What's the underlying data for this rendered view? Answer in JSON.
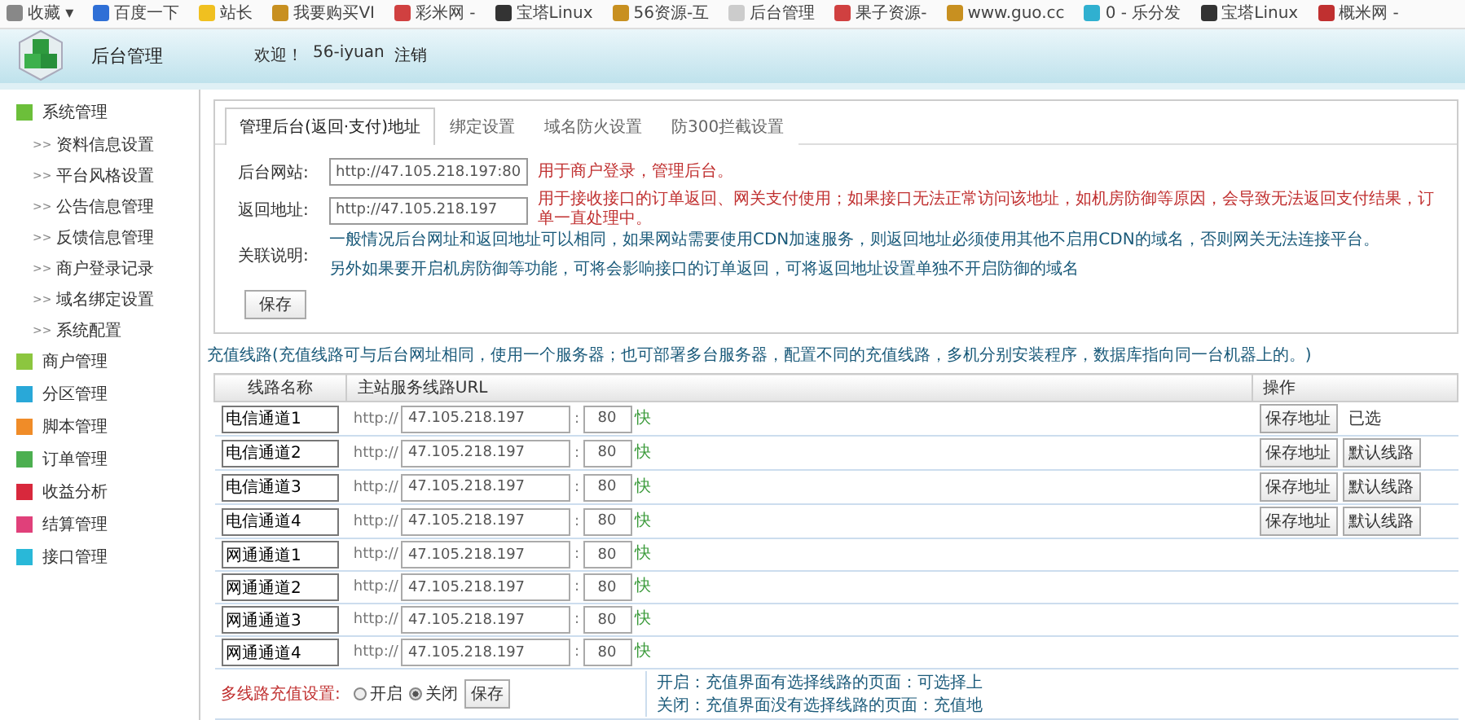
{
  "bookmarks": [
    {
      "label": "收藏 ▾",
      "color": "#888888"
    },
    {
      "label": "百度一下",
      "color": "#2f6fd6"
    },
    {
      "label": "站长",
      "color": "#f0c020"
    },
    {
      "label": "我要购买VI",
      "color": "#c89020"
    },
    {
      "label": "彩米网 -",
      "color": "#d04040"
    },
    {
      "label": "宝塔Linux",
      "color": "#333333"
    },
    {
      "label": "56资源-互",
      "color": "#c89020"
    },
    {
      "label": "后台管理",
      "color": "#cccccc"
    },
    {
      "label": "果子资源-",
      "color": "#d04040"
    },
    {
      "label": "www.guo.cc",
      "color": "#c89020"
    },
    {
      "label": "0 - 乐分发",
      "color": "#30b0d0"
    },
    {
      "label": "宝塔Linux",
      "color": "#333333"
    },
    {
      "label": "概米网 -",
      "color": "#c03030"
    }
  ],
  "header": {
    "title": "后台管理",
    "welcome": "欢迎！",
    "user": "56-iyuan",
    "logout": "注销"
  },
  "sidebar": [
    {
      "label": "系统管理",
      "color": "#6cbf3a",
      "children": [
        {
          "marker": ">>",
          "label": "资料信息设置"
        },
        {
          "marker": ">>",
          "label": "平台风格设置"
        },
        {
          "marker": ">>",
          "label": "公告信息管理"
        },
        {
          "marker": ">>",
          "label": "反馈信息管理"
        },
        {
          "marker": ">>",
          "label": "商户登录记录"
        },
        {
          "marker": ">>",
          "label": "域名绑定设置"
        },
        {
          "marker": ">>",
          "label": "系统配置"
        }
      ]
    },
    {
      "label": "商户管理",
      "color": "#8cc63f"
    },
    {
      "label": "分区管理",
      "color": "#29a8d8"
    },
    {
      "label": "脚本管理",
      "color": "#f08c28"
    },
    {
      "label": "订单管理",
      "color": "#4caf50"
    },
    {
      "label": "收益分析",
      "color": "#d8283c"
    },
    {
      "label": "结算管理",
      "color": "#e0407a"
    },
    {
      "label": "接口管理",
      "color": "#29b8d8"
    }
  ],
  "tabs": [
    {
      "label": "管理后台(返回·支付)地址",
      "selected": true
    },
    {
      "label": "绑定设置",
      "selected": false
    },
    {
      "label": "域名防火设置",
      "selected": false
    },
    {
      "label": "防300拦截设置",
      "selected": false
    }
  ],
  "form": [
    {
      "label": "后台网站:",
      "value": "http://47.105.218.197:80",
      "note": "用于商户登录，管理后台。"
    },
    {
      "label": "返回地址:",
      "value": "http://47.105.218.197",
      "note": "用于接收接口的订单返回、网关支付使用；如果接口无法正常访问该地址，如机房防御等原因，会导致无法返回支付结果，订单一直处理中。"
    }
  ],
  "explain": {
    "label": "关联说明:",
    "lines": [
      "一般情况后台网址和返回地址可以相同，如果网站需要使用CDN加速服务，则返回地址必须使用其他不启用CDN的域名，否则网关无法连接平台。",
      "另外如果要开启机房防御等功能，可将会影响接口的订单返回，可将返回地址设置单独不开启防御的域名"
    ]
  },
  "save_button": "保存",
  "lines_note": "充值线路(充值线路可与后台网址相同，使用一个服务器；也可部署多台服务器，配置不同的充值线路，多机分别安装程序，数据库指向同一台机器上的。)",
  "table": {
    "columns": [
      "线路名称",
      "主站服务线路URL",
      "操作"
    ],
    "rows": [
      {
        "name": "电信通道1",
        "prefix": "http://",
        "host": "47.105.218.197",
        "sep": ":",
        "port": "80",
        "speed": "快",
        "actions": [
          "保存地址"
        ],
        "status": "已选"
      },
      {
        "name": "电信通道2",
        "prefix": "http://",
        "host": "47.105.218.197",
        "sep": ":",
        "port": "80",
        "speed": "快",
        "actions": [
          "保存地址",
          "默认线路"
        ]
      },
      {
        "name": "电信通道3",
        "prefix": "http://",
        "host": "47.105.218.197",
        "sep": ":",
        "port": "80",
        "speed": "快",
        "actions": [
          "保存地址",
          "默认线路"
        ]
      },
      {
        "name": "电信通道4",
        "prefix": "http://",
        "host": "47.105.218.197",
        "sep": ":",
        "port": "80",
        "speed": "快",
        "actions": [
          "保存地址",
          "默认线路"
        ]
      },
      {
        "name": "网通通道1",
        "prefix": "http://",
        "host": "47.105.218.197",
        "sep": ":",
        "port": "80",
        "speed": "快"
      },
      {
        "name": "网通通道2",
        "prefix": "http://",
        "host": "47.105.218.197",
        "sep": ":",
        "port": "80",
        "speed": "快"
      },
      {
        "name": "网通通道3",
        "prefix": "http://",
        "host": "47.105.218.197",
        "sep": ":",
        "port": "80",
        "speed": "快"
      },
      {
        "name": "网通通道4",
        "prefix": "http://",
        "host": "47.105.218.197",
        "sep": ":",
        "port": "80",
        "speed": "快"
      }
    ],
    "footer": {
      "label": "多线路充值设置:",
      "options": [
        {
          "label": "开启",
          "selected": false
        },
        {
          "label": "关闭",
          "selected": true
        }
      ],
      "button": "保存",
      "notes": [
        "开启：充值界面有选择线路的页面：可选择上",
        "关闭：充值界面没有选择线路的页面：充值地"
      ]
    }
  }
}
